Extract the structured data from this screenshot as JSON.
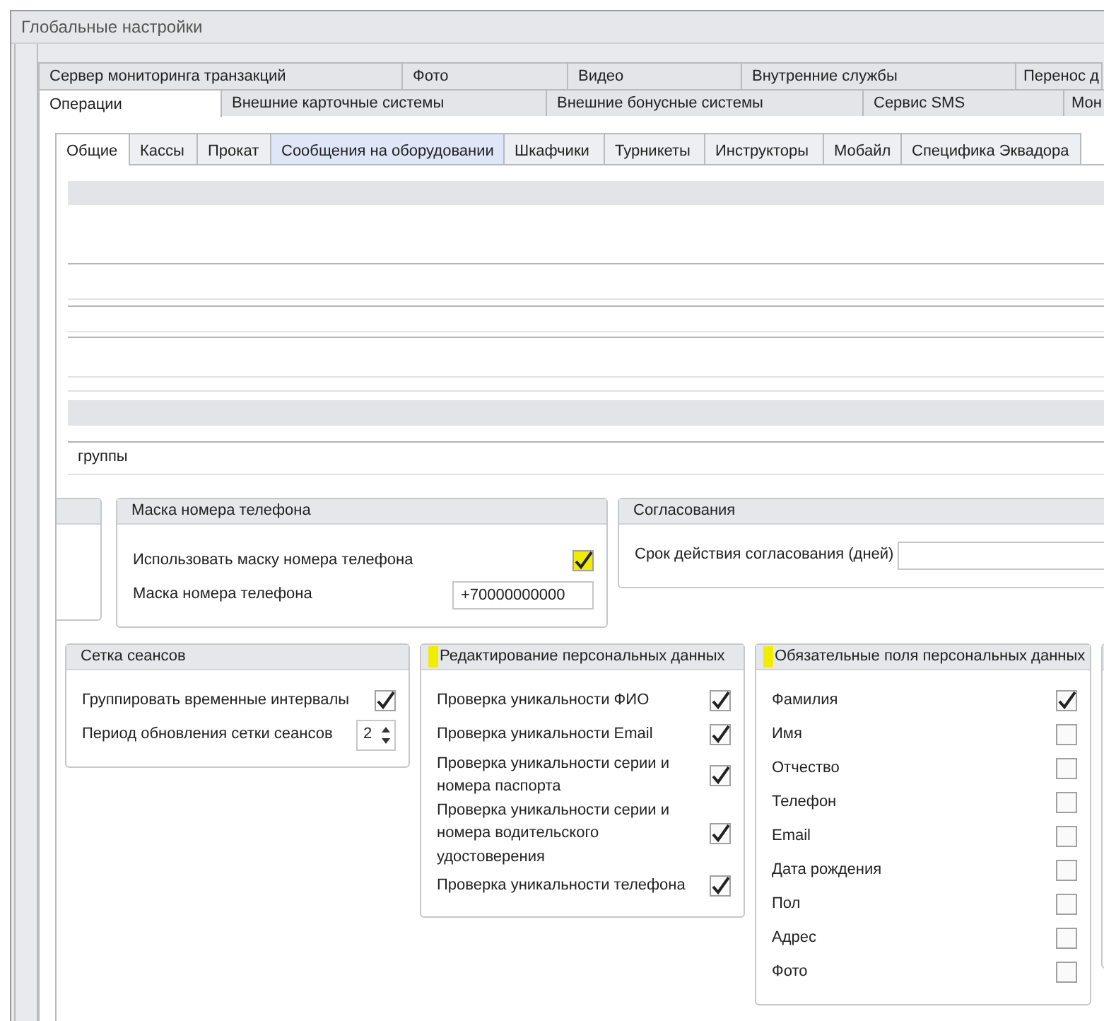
{
  "window": {
    "title": "Глобальные настройки"
  },
  "top_tabs": [
    [
      {
        "label": "Сервер мониторинга транзакций",
        "selected": false
      },
      {
        "label": "Фото",
        "selected": false
      },
      {
        "label": "Видео",
        "selected": false
      },
      {
        "label": "Внутренние службы",
        "selected": false
      },
      {
        "label": "Перенос д",
        "selected": false
      }
    ],
    [
      {
        "label": "Операции",
        "selected": true
      },
      {
        "label": "Внешние карточные системы",
        "selected": false
      },
      {
        "label": "Внешние бонусные системы",
        "selected": false
      },
      {
        "label": "Сервис SMS",
        "selected": false
      },
      {
        "label": "Мон",
        "selected": false
      }
    ]
  ],
  "inner_tabs": [
    {
      "label": "Общие",
      "selected": true,
      "highlighted": false
    },
    {
      "label": "Кассы",
      "selected": false,
      "highlighted": false
    },
    {
      "label": "Прокат",
      "selected": false,
      "highlighted": false
    },
    {
      "label": "Сообщения на оборудовании",
      "selected": false,
      "highlighted": true
    },
    {
      "label": "Шкафчики",
      "selected": false,
      "highlighted": false
    },
    {
      "label": "Турникеты",
      "selected": false,
      "highlighted": false
    },
    {
      "label": "Инструкторы",
      "selected": false,
      "highlighted": false
    },
    {
      "label": "Мобайл",
      "selected": false,
      "highlighted": false
    },
    {
      "label": "Специфика Эквадора",
      "selected": false,
      "highlighted": false
    }
  ],
  "cut_row_text": "группы",
  "group_rows": [
    [
      {
        "title": "Маска номера телефона",
        "highlighted": false,
        "rows": [
          {
            "kind": "checkbox",
            "label": "Использовать маску номера телефона",
            "checked": true,
            "highlighted": true
          },
          {
            "kind": "input",
            "label": "Маска номера телефона",
            "value": "+70000000000"
          }
        ]
      },
      {
        "title": "Согласования",
        "highlighted": false,
        "rows": [
          {
            "kind": "input",
            "label": "Срок действия согласования (дней)"
          }
        ]
      }
    ],
    [
      {
        "title": "Сетка сеансов",
        "highlighted": false,
        "rows": [
          {
            "kind": "checkbox",
            "label": "Группировать временные интервалы",
            "checked": true,
            "highlighted": false
          },
          {
            "kind": "spinner",
            "label": "Период обновления сетки сеансов",
            "value": "2"
          }
        ]
      },
      {
        "title": "Редактирование персональных данных",
        "highlighted": true,
        "rows": [
          {
            "kind": "checkbox",
            "label": "Проверка уникальности ФИО",
            "checked": true,
            "highlighted": false
          },
          {
            "kind": "checkbox",
            "label": "Проверка уникальности Email",
            "checked": true,
            "highlighted": false
          },
          {
            "kind": "checkbox",
            "label": "Проверка уникальности серии и номера паспорта",
            "checked": true,
            "highlighted": false
          },
          {
            "kind": "checkbox",
            "label": "Проверка уникальности серии и номера водительского удостоверения",
            "checked": true,
            "highlighted": false
          },
          {
            "kind": "checkbox",
            "label": "Проверка уникальности телефона",
            "checked": true,
            "highlighted": false
          }
        ]
      },
      {
        "title": "Обязательные поля персональных данных",
        "highlighted": true,
        "rows": [
          {
            "kind": "checkbox",
            "label": "Фамилия",
            "checked": true,
            "highlighted": false
          },
          {
            "kind": "checkbox",
            "label": "Имя",
            "checked": false,
            "highlighted": false
          },
          {
            "kind": "checkbox",
            "label": "Отчество",
            "checked": false,
            "highlighted": false
          },
          {
            "kind": "checkbox",
            "label": "Телефон",
            "checked": false,
            "highlighted": false
          },
          {
            "kind": "checkbox",
            "label": "Email",
            "checked": false,
            "highlighted": false
          },
          {
            "kind": "checkbox",
            "label": "Дата рождения",
            "checked": false,
            "highlighted": false
          },
          {
            "kind": "checkbox",
            "label": "Пол",
            "checked": false,
            "highlighted": false
          },
          {
            "kind": "checkbox",
            "label": "Адрес",
            "checked": false,
            "highlighted": false
          },
          {
            "kind": "checkbox",
            "label": "Фото",
            "checked": false,
            "highlighted": false
          }
        ]
      }
    ]
  ]
}
